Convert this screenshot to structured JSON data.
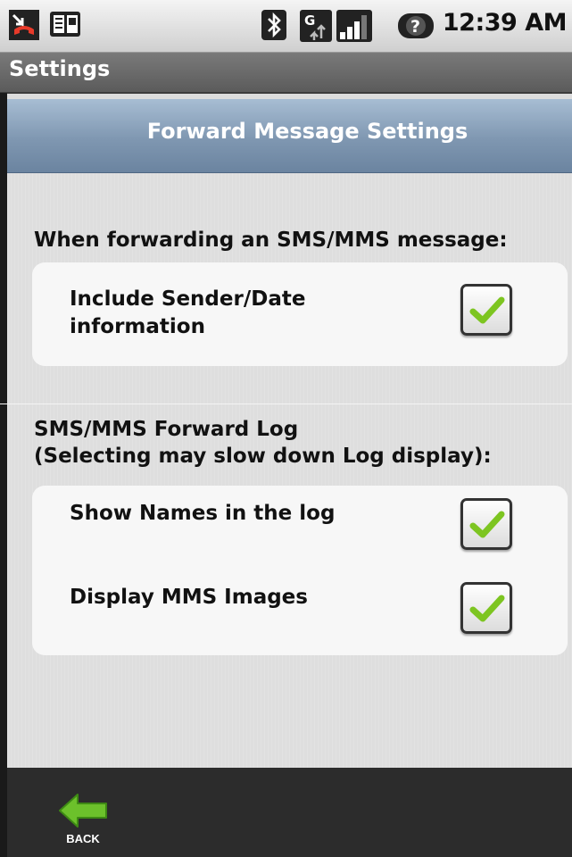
{
  "status_bar": {
    "time": "12:39 AM",
    "icons": [
      "missed-call-icon",
      "sim-card-icon",
      "bluetooth-icon",
      "network-g-icon",
      "signal-bars-icon",
      "unknown-battery-icon"
    ]
  },
  "title_bar": {
    "title": "Settings"
  },
  "header": {
    "title": "Forward Message Settings"
  },
  "section_forwarding": {
    "label": "When forwarding an SMS/MMS message:",
    "options": [
      {
        "label_line1": "Include Sender/Date",
        "label_line2": "information",
        "checked": true
      }
    ]
  },
  "section_log": {
    "label_line1": "SMS/MMS Forward Log",
    "label_line2": "(Selecting may slow down Log display):",
    "options": [
      {
        "label": "Show Names in the log",
        "checked": true
      },
      {
        "label": "Display MMS Images",
        "checked": true
      }
    ]
  },
  "bottom_bar": {
    "back_label": "BACK"
  },
  "colors": {
    "header_blue": "#7f97b1",
    "check_green": "#7dc521",
    "back_arrow_green": "#6cc12b"
  }
}
